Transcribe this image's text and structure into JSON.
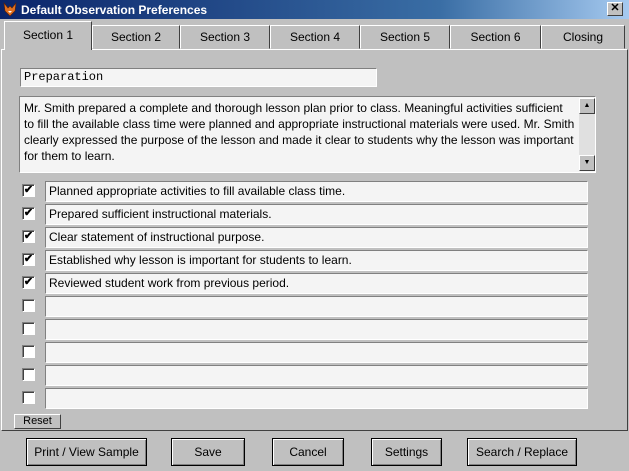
{
  "window": {
    "title": "Default Observation Preferences",
    "close_glyph": "✕"
  },
  "tabs": [
    "Section 1",
    "Section 2",
    "Section 3",
    "Section 4",
    "Section 5",
    "Section 6",
    "Closing"
  ],
  "active_tab": "Section 1",
  "section": {
    "title": "Preparation",
    "narrative": "Mr. Smith prepared a complete and thorough lesson plan prior to class.  Meaningful activities sufficient to fill the available class time were planned and appropriate instructional materials were used.  Mr. Smith clearly expressed the purpose of the lesson and made it clear to students why the lesson was important for them to learn."
  },
  "checklist": [
    {
      "checked": true,
      "text": "Planned appropriate activities to fill available class time."
    },
    {
      "checked": true,
      "text": "Prepared sufficient instructional materials."
    },
    {
      "checked": true,
      "text": "Clear statement of instructional purpose."
    },
    {
      "checked": true,
      "text": "Established why lesson is important for students to learn."
    },
    {
      "checked": true,
      "text": "Reviewed student work from previous period."
    },
    {
      "checked": false,
      "text": ""
    },
    {
      "checked": false,
      "text": ""
    },
    {
      "checked": false,
      "text": ""
    },
    {
      "checked": false,
      "text": ""
    },
    {
      "checked": false,
      "text": ""
    }
  ],
  "check_glyph": "✔",
  "reset_label": "Reset",
  "buttons": {
    "print": "Print / View Sample",
    "save": "Save",
    "cancel": "Cancel",
    "settings": "Settings",
    "search_replace": "Search / Replace"
  },
  "icons": {
    "app": "fox-icon",
    "scroll_up": "▲",
    "scroll_down": "▼"
  }
}
